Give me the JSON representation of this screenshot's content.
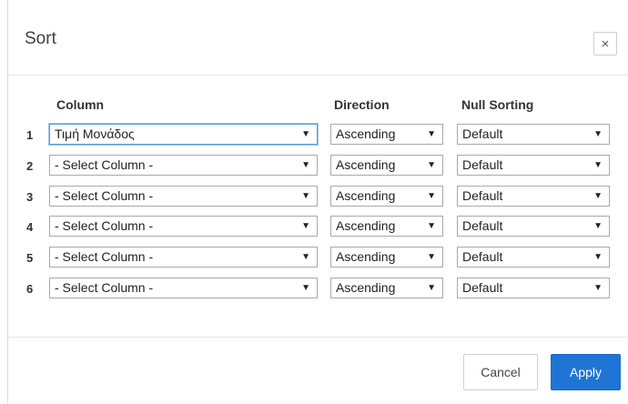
{
  "dialog": {
    "title": "Sort",
    "close_label": "×"
  },
  "columns": {
    "column": "Column",
    "direction": "Direction",
    "null_sorting": "Null Sorting"
  },
  "rows": [
    {
      "num": "1",
      "column": "Τιμή Μονάδος",
      "direction": "Ascending",
      "null_sorting": "Default"
    },
    {
      "num": "2",
      "column": "- Select Column -",
      "direction": "Ascending",
      "null_sorting": "Default"
    },
    {
      "num": "3",
      "column": "- Select Column -",
      "direction": "Ascending",
      "null_sorting": "Default"
    },
    {
      "num": "4",
      "column": "- Select Column -",
      "direction": "Ascending",
      "null_sorting": "Default"
    },
    {
      "num": "5",
      "column": "- Select Column -",
      "direction": "Ascending",
      "null_sorting": "Default"
    },
    {
      "num": "6",
      "column": "- Select Column -",
      "direction": "Ascending",
      "null_sorting": "Default"
    }
  ],
  "dropdown_arrow": "▼",
  "footer": {
    "cancel_label": "Cancel",
    "apply_label": "Apply"
  },
  "colors": {
    "apply_button": "#1f75d3",
    "focus_border": "#5b9bd5"
  }
}
